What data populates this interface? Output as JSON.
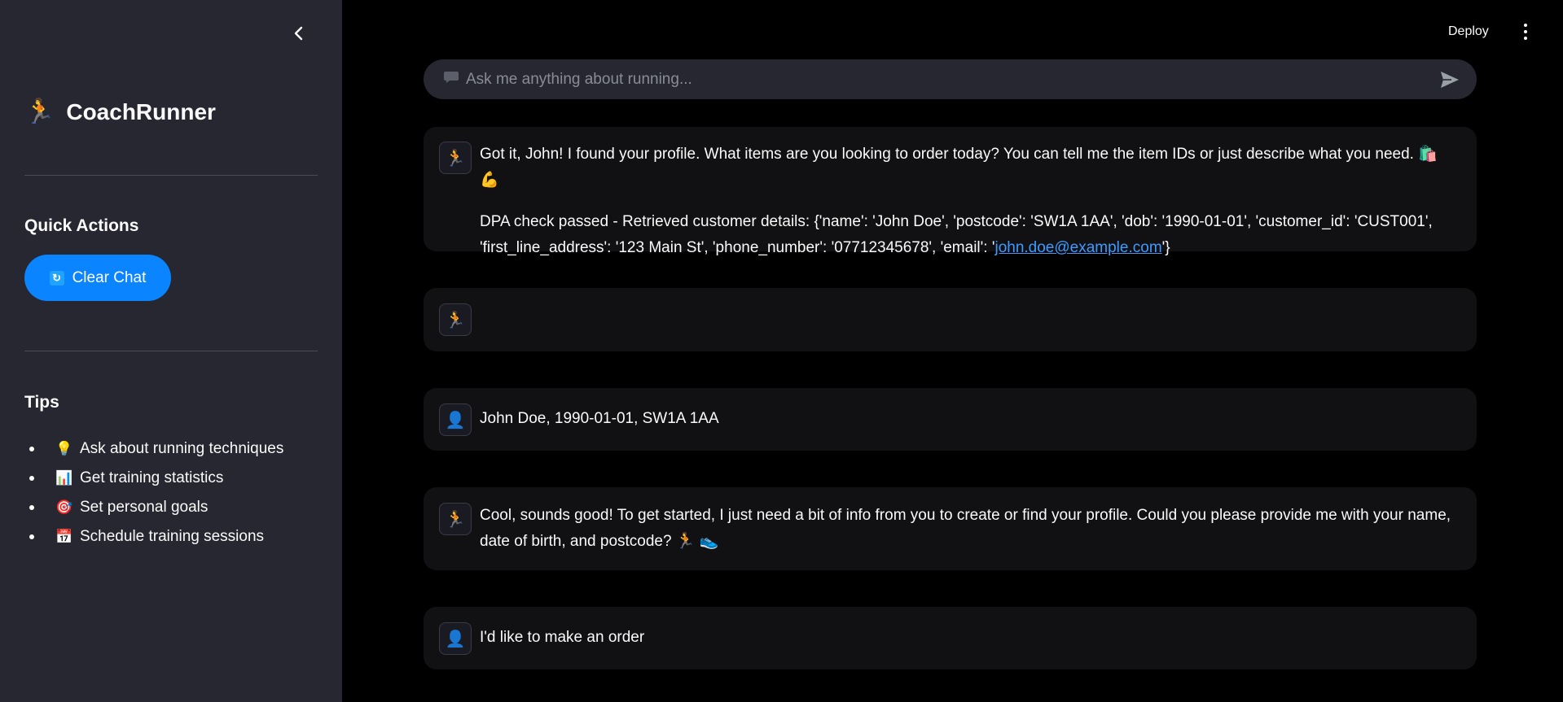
{
  "sidebar": {
    "brand_emoji": "🏃",
    "brand_title": "CoachRunner",
    "quick_actions_title": "Quick Actions",
    "clear_chat_label": "Clear Chat",
    "clear_chat_icon": "🔄",
    "tips_title": "Tips",
    "tips": [
      {
        "icon": "💡",
        "label": "Ask about running techniques"
      },
      {
        "icon": "📊",
        "label": "Get training statistics"
      },
      {
        "icon": "🎯",
        "label": "Set personal goals"
      },
      {
        "icon": "📅",
        "label": "Schedule training sessions"
      }
    ]
  },
  "header": {
    "deploy_label": "Deploy"
  },
  "chat_input": {
    "placeholder": "Ask me anything about running..."
  },
  "messages": [
    {
      "role": "assistant",
      "avatar": "🏃",
      "paragraphs": [
        "Got it, John! I found your profile. What items are you looking to order today? You can tell me the item IDs or just describe what you need. 🛍️ 💪"
      ],
      "detail_prefix": "DPA check passed - Retrieved customer details: {'name': 'John Doe', 'postcode': 'SW1A 1AA', 'dob': '1990-01-01', 'customer_id': 'CUST001', 'first_line_address': '123 Main St', 'phone_number': '07712345678', 'email': '",
      "detail_link": "john.doe@example.com",
      "detail_suffix": "'}"
    },
    {
      "role": "assistant",
      "avatar": "🏃",
      "text": ""
    },
    {
      "role": "user",
      "avatar": "👤",
      "text": "John Doe, 1990-01-01, SW1A 1AA"
    },
    {
      "role": "assistant",
      "avatar": "🏃",
      "text": "Cool, sounds good! To get started, I just need a bit of info from you to create or find your profile. Could you please provide me with your name, date of birth, and postcode? 🏃 👟"
    },
    {
      "role": "user",
      "avatar": "👤",
      "text": "I'd like to make an order"
    }
  ],
  "colors": {
    "sidebar_bg": "#262730",
    "main_bg": "#000000",
    "accent": "#0b84ff",
    "link": "#3d9bff"
  }
}
